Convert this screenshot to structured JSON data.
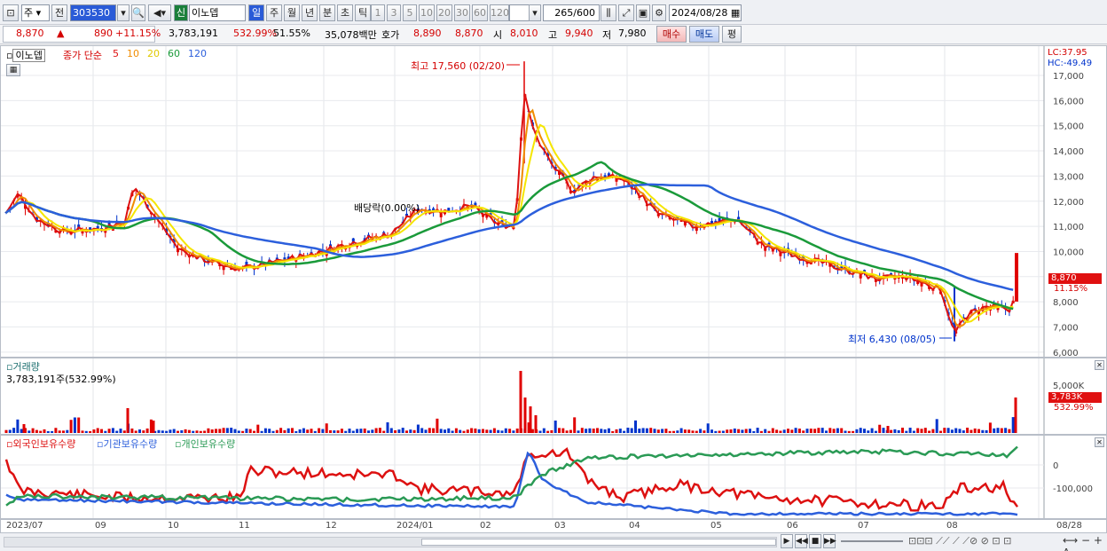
{
  "toolbar": {
    "period_select": "주",
    "prev_label": "전",
    "code": "303530",
    "market_badge": "신",
    "stock_name": "이노뎁",
    "period_tabs": [
      "일",
      "주",
      "월",
      "년",
      "분",
      "초",
      "틱"
    ],
    "interval_buttons": [
      "1",
      "3",
      "5",
      "10",
      "20",
      "30",
      "60",
      "120"
    ],
    "count_value": "265",
    "count_total": "/600",
    "date_value": "2024/08/28"
  },
  "quote": {
    "price": "8,870",
    "change_arrow": "▲",
    "change": "890",
    "change_pct": "+11.15%",
    "volume": "3,783,191",
    "volume_ratio": "532.99%",
    "turnover_rate": "51.55%",
    "amount": "35,078백만",
    "ask_label": "호가",
    "ask": "8,890",
    "bid": "8,870",
    "open_label": "시",
    "open": "8,010",
    "high_label": "고",
    "high": "9,940",
    "low_label": "저",
    "low": "7,980",
    "buy_button": "매수",
    "sell_button": "매도",
    "eval_button": "평"
  },
  "chart": {
    "stock_label": "이노뎁",
    "ma_title": "종가 단순",
    "ma_periods": [
      "5",
      "10",
      "20",
      "60",
      "120"
    ],
    "lc_label": "LC:37.95",
    "hc_label": "HC:-49.49",
    "high_annotation": "최고 17,560 (02/20)",
    "low_annotation": "최저 6,430 (08/05)",
    "dividend_annotation": "배당락(0.00%)",
    "price_tag": "8,870",
    "pct_tag": "11.15%",
    "volume_title": "거래량",
    "volume_info": "3,783,191주(532.99%)",
    "volume_tag": "3,783K",
    "volume_pct_tag": "532.99%",
    "ownership_legend": [
      "외국인보유수량",
      "기관보유수량",
      "개인보유수량"
    ],
    "x_labels": [
      "2023/07",
      "09",
      "10",
      "11",
      "12",
      "2024/01",
      "02",
      "03",
      "04",
      "05",
      "06",
      "07",
      "08",
      "08/28"
    ],
    "price_axis": [
      "17,000",
      "16,000",
      "15,000",
      "14,000",
      "13,000",
      "12,000",
      "11,000",
      "10,000",
      "9,000",
      "8,000",
      "7,000",
      "6,000"
    ],
    "volume_axis": [
      "5,000K"
    ],
    "ownership_axis": [
      "0",
      "-100,000"
    ]
  },
  "colors": {
    "up": "#e00000",
    "down": "#0033cc",
    "ma5": "#dd1111",
    "ma10": "#f08c00",
    "ma20": "#f5e600",
    "ma60": "#1a9a3a",
    "ma120": "#2c5fdc",
    "foreign": "#dd1111",
    "institution": "#2c5fdc",
    "individual": "#2a9a55"
  }
}
